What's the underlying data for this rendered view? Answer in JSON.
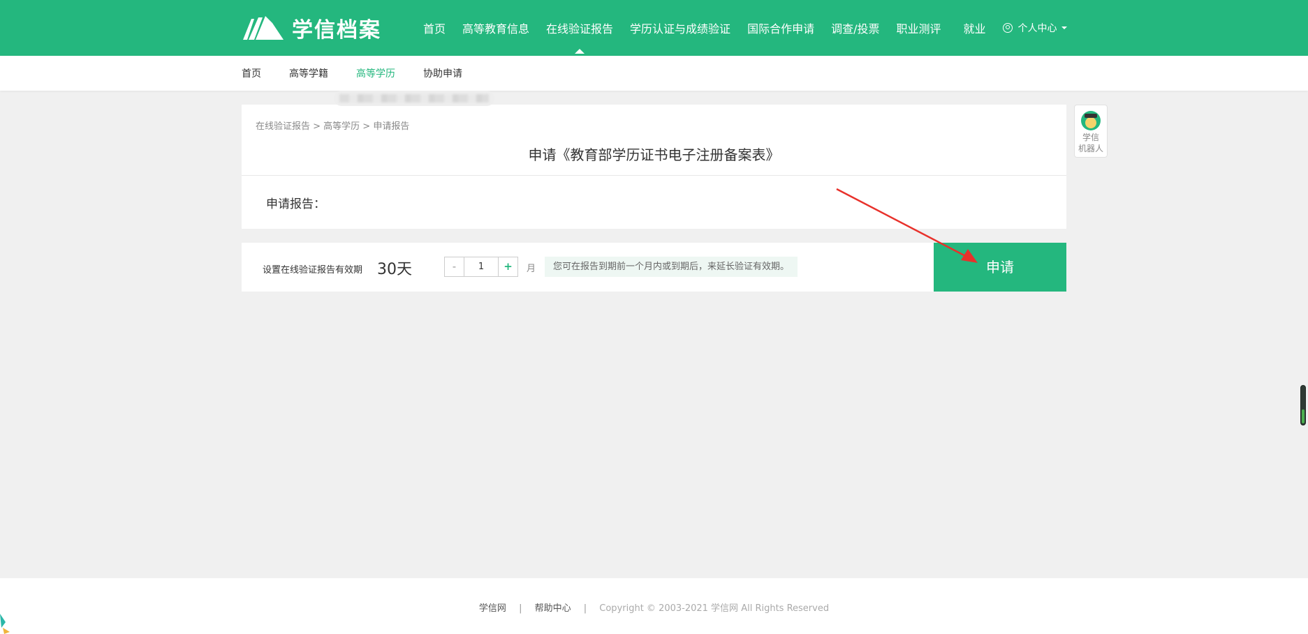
{
  "header": {
    "logo_text": "学信档案",
    "nav": [
      {
        "label": "首页"
      },
      {
        "label": "高等教育信息"
      },
      {
        "label": "在线验证报告"
      },
      {
        "label": "学历认证与成绩验证"
      },
      {
        "label": "国际合作申请"
      },
      {
        "label": "调查/投票"
      },
      {
        "label": "职业测评"
      },
      {
        "label": "就业"
      }
    ],
    "user_menu": "个人中心"
  },
  "subnav": [
    {
      "label": "首页"
    },
    {
      "label": "高等学籍"
    },
    {
      "label": "高等学历"
    },
    {
      "label": "协助申请"
    }
  ],
  "card": {
    "breadcrumb": "在线验证报告 > 高等学历 > 申请报告",
    "title": "申请《教育部学历证书电子注册备案表》",
    "report_label": "申请报告：",
    "report_value": ""
  },
  "validity": {
    "label": "设置在线验证报告有效期",
    "days": "30天",
    "minus": "-",
    "value": "1",
    "plus": "+",
    "unit": "月",
    "hint": "您可在报告到期前一个月内或到期后，来延长验证有效期。",
    "apply_label": "申请"
  },
  "robot": {
    "line1": "学信",
    "line2": "机器人"
  },
  "footer": {
    "link1": "学信网",
    "sep": "|",
    "link2": "帮助中心",
    "copyright": "Copyright © 2003-2021 学信网 All Rights Reserved"
  },
  "colors": {
    "brand": "#24b77e",
    "page_bg": "#f0f0f0"
  }
}
